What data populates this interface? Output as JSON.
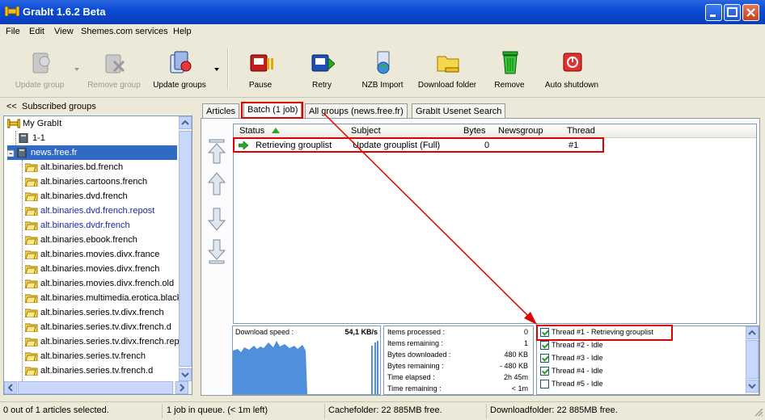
{
  "window": {
    "title": "GrabIt 1.6.2 Beta"
  },
  "menu": [
    "File",
    "Edit",
    "View",
    "Shemes.com services",
    "Help"
  ],
  "toolbar": {
    "update_group": "Update group",
    "remove_group": "Remove group",
    "update_groups": "Update groups",
    "pause": "Pause",
    "retry": "Retry",
    "nzb_import": "NZB Import",
    "download_folder": "Download folder",
    "remove": "Remove",
    "auto_shutdown": "Auto shutdown"
  },
  "left": {
    "collapse": "<<",
    "header": "Subscribed groups",
    "tree": [
      {
        "label": "My GrabIt"
      },
      {
        "label": "1-1"
      },
      {
        "label": "news.free.fr"
      },
      {
        "label": "alt.binaries.bd.french"
      },
      {
        "label": "alt.binaries.cartoons.french"
      },
      {
        "label": "alt.binaries.dvd.french"
      },
      {
        "label": "alt.binaries.dvd.french.repost"
      },
      {
        "label": "alt.binaries.dvdr.french"
      },
      {
        "label": "alt.binaries.ebook.french"
      },
      {
        "label": "alt.binaries.movies.divx.france"
      },
      {
        "label": "alt.binaries.movies.divx.french"
      },
      {
        "label": "alt.binaries.movies.divx.french.old"
      },
      {
        "label": "alt.binaries.multimedia.erotica.black"
      },
      {
        "label": "alt.binaries.series.tv.divx.french"
      },
      {
        "label": "alt.binaries.series.tv.divx.french.d"
      },
      {
        "label": "alt.binaries.series.tv.divx.french.repo"
      },
      {
        "label": "alt.binaries.series.tv.french"
      },
      {
        "label": "alt.binaries.series.tv.french.d"
      }
    ]
  },
  "tabs": [
    "Articles",
    "Batch (1 job)",
    "All groups (news.free.fr)",
    "GrabIt Usenet Search"
  ],
  "grid": {
    "columns": [
      "Status",
      "Subject",
      "Bytes",
      "Newsgroup",
      "Thread"
    ],
    "row": {
      "status": "Retrieving grouplist",
      "subject": "Update grouplist (Full)",
      "bytes": "0",
      "newsgroup": "",
      "thread": "#1"
    }
  },
  "speed": {
    "label": "Download speed :",
    "value": "54,1 KB/s"
  },
  "stats": [
    {
      "label": "Items processed :",
      "value": "0"
    },
    {
      "label": "Items remaining :",
      "value": "1"
    },
    {
      "label": "Bytes downloaded :",
      "value": "480 KB"
    },
    {
      "label": "Bytes remaining :",
      "value": "- 480 KB"
    },
    {
      "label": "Time elapsed :",
      "value": "2h 45m"
    },
    {
      "label": "Time remaining :",
      "value": "< 1m"
    }
  ],
  "threads": [
    {
      "label": "Thread #1 - Retrieving grouplist",
      "checked": true
    },
    {
      "label": "Thread #2 - Idle",
      "checked": true
    },
    {
      "label": "Thread #3 - Idle",
      "checked": true
    },
    {
      "label": "Thread #4 - Idle",
      "checked": true
    },
    {
      "label": "Thread #5 - Idle",
      "checked": false
    }
  ],
  "status": {
    "selection": "0 out of 1 articles selected.",
    "queue": "1 job in queue. (< 1m left)",
    "cache": "Cachefolder: 22 885MB free.",
    "download": "Downloadfolder: 22 885MB free."
  },
  "colors": {
    "accent": "#316ac5",
    "highlight": "#e00000",
    "graph": "#4f8fdc"
  }
}
